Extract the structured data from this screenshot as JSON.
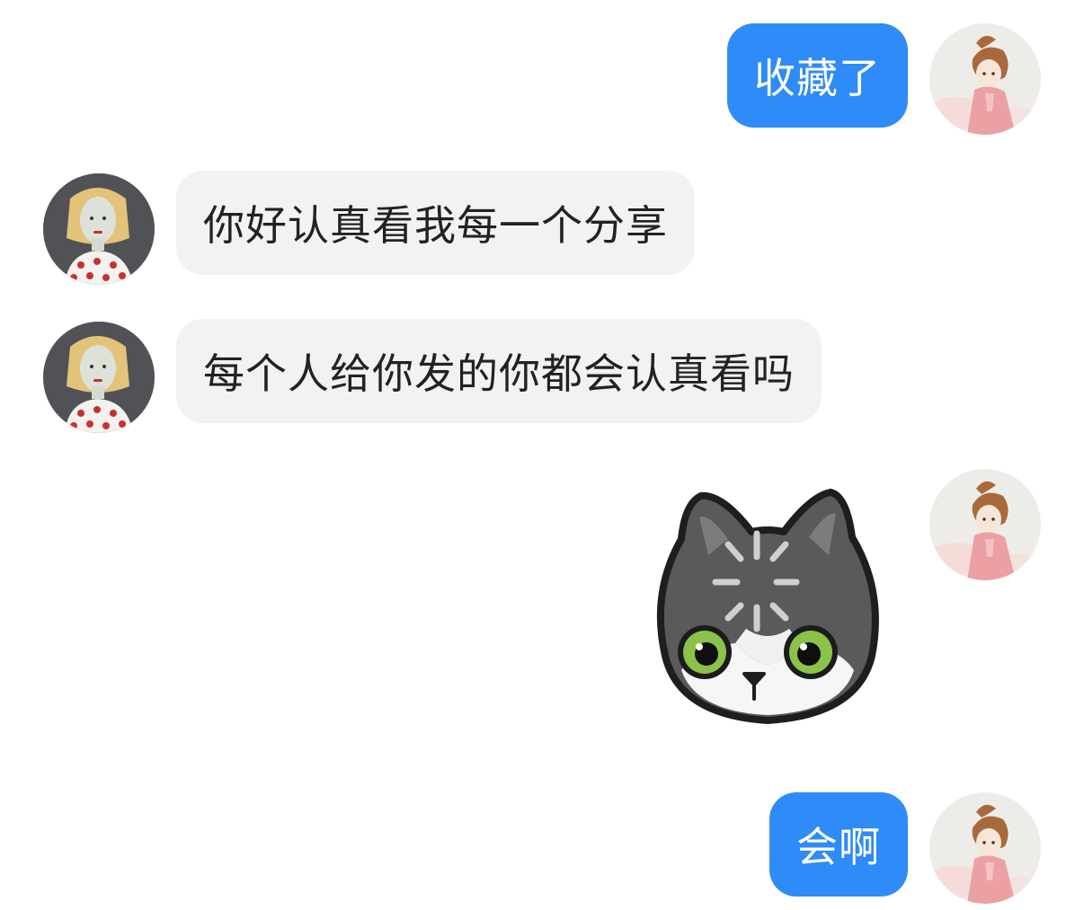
{
  "chat": {
    "messages": [
      {
        "direction": "outgoing",
        "type": "text",
        "text": "收藏了"
      },
      {
        "direction": "incoming",
        "type": "text",
        "text": "你好认真看我每一个分享"
      },
      {
        "direction": "incoming",
        "type": "text",
        "text": "每个人给你发的你都会认真看吗"
      },
      {
        "direction": "outgoing",
        "type": "sticker",
        "sticker": "gray-cat-loading-spinner-icon"
      },
      {
        "direction": "outgoing",
        "type": "text",
        "text": "会啊"
      }
    ]
  },
  "avatars": {
    "self": "anime-girl-pink-outfit-avatar",
    "other": "blonde-girl-red-polka-dot-avatar"
  },
  "colors": {
    "outgoing_bubble": "#2e8bf7",
    "incoming_bubble": "#f2f2f4",
    "background": "#ffffff"
  }
}
